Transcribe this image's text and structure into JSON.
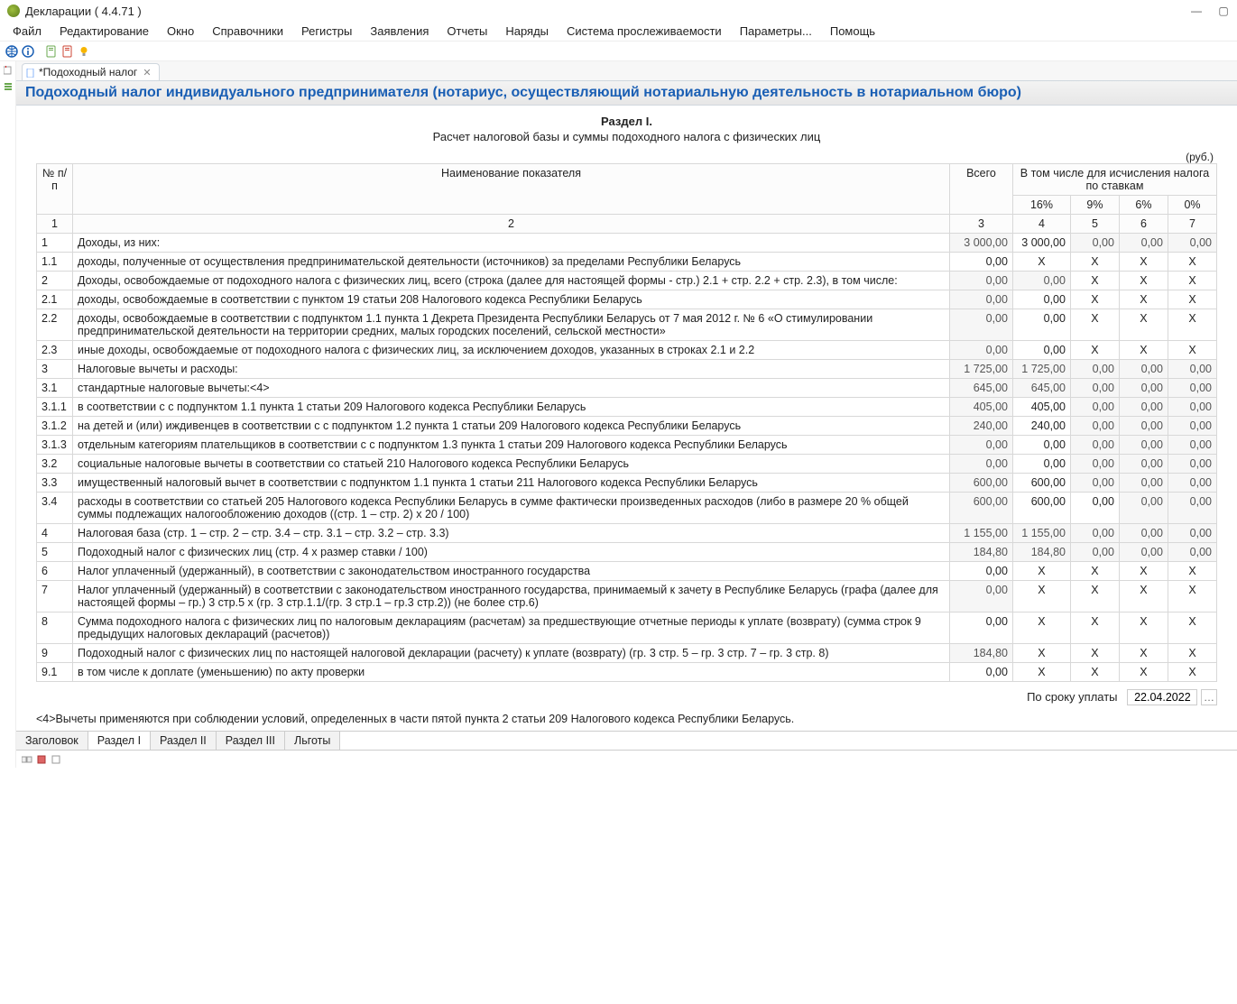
{
  "app": {
    "title": "Декларации ( 4.4.71 )"
  },
  "menu": [
    "Файл",
    "Редактирование",
    "Окно",
    "Справочники",
    "Регистры",
    "Заявления",
    "Отчеты",
    "Наряды",
    "Система прослеживаемости",
    "Параметры...",
    "Помощь"
  ],
  "tab": {
    "label": "*Подоходный налог"
  },
  "doc": {
    "header": "Подоходный налог индивидуального предпринимателя (нотариус, осуществляющий нотариальную деятельность в нотариальном бюро)",
    "section_title": "Раздел I.",
    "section_sub": "Расчет налоговой базы и суммы подоходного налога с физических лиц",
    "unit": "(руб.)"
  },
  "columns": {
    "num": "№ п/п",
    "name": "Наименование показателя",
    "total": "Всего",
    "rates_header": "В том числе для исчисления налога по ставкам",
    "rates": [
      "16%",
      "9%",
      "6%",
      "0%"
    ],
    "header_row2": [
      "1",
      "2",
      "3",
      "4",
      "5",
      "6",
      "7"
    ]
  },
  "rows": [
    {
      "n": "1",
      "name": "Доходы, из них:",
      "total": "3 000,00",
      "c": [
        "3 000,00",
        "0,00",
        "0,00",
        "0,00"
      ],
      "ro_total": true,
      "ro_c": [
        false,
        true,
        true,
        true
      ],
      "ro_name": false
    },
    {
      "n": "1.1",
      "name": "доходы, полученные от осуществления предпринимательской деятельности (источников) за пределами Республики Беларусь",
      "total": "0,00",
      "c": [
        "X",
        "X",
        "X",
        "X"
      ],
      "ro_total": false,
      "x": [
        true,
        true,
        true,
        true
      ]
    },
    {
      "n": "2",
      "name": "Доходы, освобождаемые от подоходного налога с физических лиц, всего (строка (далее для настоящей формы - стр.) 2.1 + стр. 2.2 + стр. 2.3), в том числе:",
      "total": "0,00",
      "c": [
        "0,00",
        "X",
        "X",
        "X"
      ],
      "ro_total": true,
      "ro_c": [
        true,
        false,
        false,
        false
      ],
      "x": [
        false,
        true,
        true,
        true
      ]
    },
    {
      "n": "2.1",
      "name": "доходы, освобождаемые в соответствии с пунктом 19 статьи 208 Налогового кодекса Республики Беларусь",
      "total": "0,00",
      "c": [
        "0,00",
        "X",
        "X",
        "X"
      ],
      "ro_total": true,
      "x": [
        false,
        true,
        true,
        true
      ]
    },
    {
      "n": "2.2",
      "name": "доходы, освобождаемые в соответствии с подпунктом 1.1 пункта 1 Декрета Президента Республики Беларусь от 7 мая 2012 г. № 6 «О стимулировании предпринимательской деятельности на территории средних, малых городских поселений, сельской местности»",
      "total": "0,00",
      "c": [
        "0,00",
        "X",
        "X",
        "X"
      ],
      "ro_total": true,
      "x": [
        false,
        true,
        true,
        true
      ]
    },
    {
      "n": "2.3",
      "name": "иные доходы, освобождаемые от подоходного налога с физических лиц, за исключением доходов, указанных в строках 2.1 и 2.2",
      "total": "0,00",
      "c": [
        "0,00",
        "X",
        "X",
        "X"
      ],
      "ro_total": true,
      "x": [
        false,
        true,
        true,
        true
      ]
    },
    {
      "n": "3",
      "name": "Налоговые вычеты и расходы:",
      "total": "1 725,00",
      "c": [
        "1 725,00",
        "0,00",
        "0,00",
        "0,00"
      ],
      "ro_total": true,
      "ro_c": [
        true,
        true,
        true,
        true
      ]
    },
    {
      "n": "3.1",
      "name": "стандартные налоговые вычеты:<4>",
      "total": "645,00",
      "c": [
        "645,00",
        "0,00",
        "0,00",
        "0,00"
      ],
      "ro_total": true,
      "ro_c": [
        true,
        true,
        true,
        true
      ]
    },
    {
      "n": "3.1.1",
      "name": "в соответствии с с подпунктом 1.1 пункта 1 статьи  209 Налогового кодекса Республики Беларусь",
      "total": "405,00",
      "c": [
        "405,00",
        "0,00",
        "0,00",
        "0,00"
      ],
      "ro_total": true,
      "ro_c": [
        false,
        true,
        true,
        true
      ]
    },
    {
      "n": "3.1.2",
      "name": "на детей и (или) иждивенцев в соответствии с с подпунктом 1.2 пункта 1 статьи 209 Налогового кодекса Республики Беларусь",
      "total": "240,00",
      "c": [
        "240,00",
        "0,00",
        "0,00",
        "0,00"
      ],
      "ro_total": true,
      "ro_c": [
        false,
        true,
        true,
        true
      ]
    },
    {
      "n": "3.1.3",
      "name": "отдельным категориям плательщиков в соответствии с с подпунктом 1.3 пункта 1 статьи 209 Налогового кодекса Республики Беларусь",
      "total": "0,00",
      "c": [
        "0,00",
        "0,00",
        "0,00",
        "0,00"
      ],
      "ro_total": true,
      "ro_c": [
        false,
        true,
        true,
        true
      ]
    },
    {
      "n": "3.2",
      "name": "социальные налоговые вычеты в соответствии со статьей 210 Налогового кодекса Республики Беларусь",
      "total": "0,00",
      "c": [
        "0,00",
        "0,00",
        "0,00",
        "0,00"
      ],
      "ro_total": true,
      "ro_c": [
        false,
        true,
        true,
        true
      ]
    },
    {
      "n": "3.3",
      "name": "имущественный налоговый вычет в соответствии с подпунктом 1.1 пункта 1 статьи 211 Налогового кодекса Республики Беларусь",
      "total": "600,00",
      "c": [
        "600,00",
        "0,00",
        "0,00",
        "0,00"
      ],
      "ro_total": true,
      "ro_c": [
        false,
        true,
        true,
        true
      ]
    },
    {
      "n": "3.4",
      "name": "расходы в соответствии со статьей 205 Налогового кодекса Республики Беларусь в сумме фактически произведенных расходов (либо в размере 20 % общей суммы подлежащих налогообложению доходов ((стр. 1 – стр. 2) x 20 / 100)",
      "total": "600,00",
      "c": [
        "600,00",
        "0,00",
        "0,00",
        "0,00"
      ],
      "ro_total": true,
      "ro_c": [
        false,
        false,
        true,
        true
      ]
    },
    {
      "n": "4",
      "name": "Налоговая база  (стр. 1 – стр. 2 – стр. 3.4 – стр. 3.1 – стр. 3.2 – стр. 3.3)",
      "total": "1 155,00",
      "c": [
        "1 155,00",
        "0,00",
        "0,00",
        "0,00"
      ],
      "ro_total": true,
      "ro_c": [
        true,
        true,
        true,
        true
      ]
    },
    {
      "n": "5",
      "name": "Подоходный налог с физических лиц  (стр. 4 x размер ставки / 100)",
      "total": "184,80",
      "c": [
        "184,80",
        "0,00",
        "0,00",
        "0,00"
      ],
      "ro_total": true,
      "ro_c": [
        true,
        true,
        true,
        true
      ]
    },
    {
      "n": "6",
      "name": "Налог уплаченный (удержанный), в соответствии с законодательством иностранного государства",
      "total": "0,00",
      "c": [
        "X",
        "X",
        "X",
        "X"
      ],
      "x": [
        true,
        true,
        true,
        true
      ]
    },
    {
      "n": "7",
      "name": "Налог уплаченный (удержанный) в соответствии с законодательством иностранного государства, принимаемый к зачету в Республике Беларусь (графа (далее для настоящей формы – гр.) 3 стр.5 x (гр. 3 стр.1.1/(гр. 3 стр.1 – гр.3 стр.2)) (не более стр.6)",
      "total": "0,00",
      "c": [
        "X",
        "X",
        "X",
        "X"
      ],
      "ro_total": true,
      "x": [
        true,
        true,
        true,
        true
      ]
    },
    {
      "n": "8",
      "name": "Сумма подоходного налога с физических лиц по налоговым декларациям (расчетам) за предшествующие отчетные периоды к уплате (возврату) (сумма строк 9 предыдущих налоговых деклараций (расчетов))",
      "total": "0,00",
      "c": [
        "X",
        "X",
        "X",
        "X"
      ],
      "x": [
        true,
        true,
        true,
        true
      ]
    },
    {
      "n": "9",
      "name": "Подоходный налог с физических лиц по настоящей налоговой декларации (расчету) к уплате (возврату) (гр. 3 стр. 5 – гр. 3 стр. 7 – гр. 3 стр. 8)",
      "total": "184,80",
      "c": [
        "X",
        "X",
        "X",
        "X"
      ],
      "ro_total": true,
      "x": [
        true,
        true,
        true,
        true
      ]
    },
    {
      "n": "9.1",
      "name": "в том числе к доплате (уменьшению) по акту проверки",
      "total": "0,00",
      "c": [
        "X",
        "X",
        "X",
        "X"
      ],
      "x": [
        true,
        true,
        true,
        true
      ]
    }
  ],
  "due": {
    "label": "По сроку уплаты",
    "date": "22.04.2022"
  },
  "footnote": "<4>Вычеты применяются при соблюдении условий, определенных в части пятой пункта 2 статьи 209 Налогового кодекса Республики Беларусь.",
  "bottom_tabs": [
    "Заголовок",
    "Раздел I",
    "Раздел II",
    "Раздел III",
    "Льготы"
  ],
  "active_bottom_tab": 1
}
